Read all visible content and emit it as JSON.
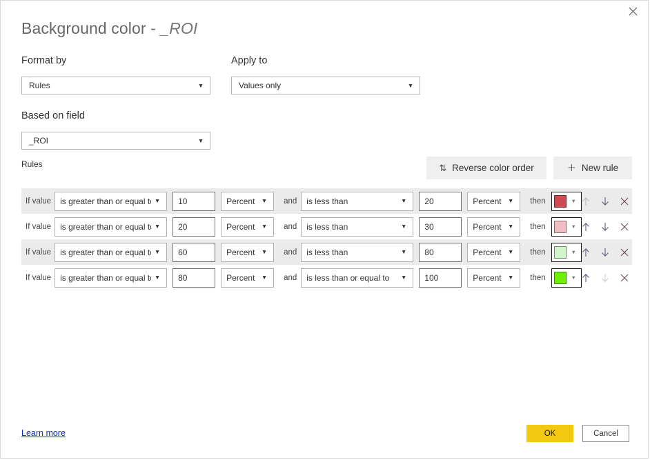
{
  "dialog": {
    "title_prefix": "Background color - ",
    "title_field": "_ROI",
    "close_label": "×"
  },
  "form": {
    "format_by": {
      "label": "Format by",
      "value": "Rules"
    },
    "apply_to": {
      "label": "Apply to",
      "value": "Values only"
    },
    "based_on_field": {
      "label": "Based on field",
      "value": "_ROI"
    }
  },
  "rules_section": {
    "label": "Rules",
    "reverse_button": "Reverse color order",
    "reverse_icon": "sort-arrows-icon",
    "new_rule_button": "New rule",
    "new_rule_icon": "plus-icon",
    "labels": {
      "if_value": "If value",
      "and": "and",
      "then": "then"
    },
    "rows": [
      {
        "min_condition": "is greater than or equal to",
        "min_value": "10",
        "min_unit": "Percent",
        "max_condition": "is less than",
        "max_value": "20",
        "max_unit": "Percent",
        "color": "#CE4A52",
        "up_enabled": false,
        "down_enabled": true,
        "striped": true
      },
      {
        "min_condition": "is greater than or equal to",
        "min_value": "20",
        "min_unit": "Percent",
        "max_condition": "is less than",
        "max_value": "30",
        "max_unit": "Percent",
        "color": "#F0BEC2",
        "up_enabled": true,
        "down_enabled": true,
        "striped": false
      },
      {
        "min_condition": "is greater than or equal to",
        "min_value": "60",
        "min_unit": "Percent",
        "max_condition": "is less than",
        "max_value": "80",
        "max_unit": "Percent",
        "color": "#D2F5CC",
        "up_enabled": true,
        "down_enabled": true,
        "striped": true
      },
      {
        "min_condition": "is greater than or equal to",
        "min_value": "80",
        "min_unit": "Percent",
        "max_condition": "is less than or equal to",
        "max_value": "100",
        "max_unit": "Percent",
        "color": "#6EF000",
        "up_enabled": true,
        "down_enabled": false,
        "striped": false
      }
    ]
  },
  "footer": {
    "learn_more": "Learn more",
    "ok": "OK",
    "cancel": "Cancel"
  },
  "colors": {
    "accent_yellow": "#F2C811",
    "link_blue": "#0B2EC9",
    "stripe_gray": "#EBEBEB",
    "button_gray": "#EFEFEF"
  }
}
